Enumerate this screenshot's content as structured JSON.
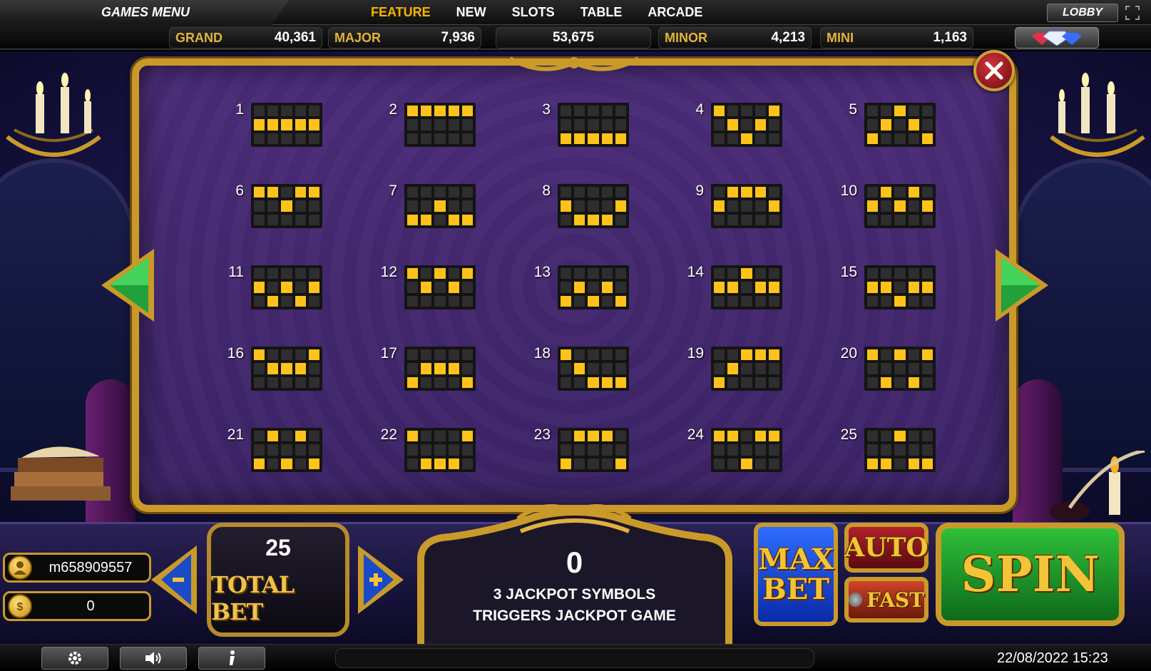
{
  "topbar": {
    "games_menu": "GAMES MENU",
    "tabs": [
      "FEATURE",
      "NEW",
      "SLOTS",
      "TABLE",
      "ARCADE"
    ],
    "active_tab": "FEATURE",
    "lobby": "LOBBY"
  },
  "jackpots": {
    "grand_label": "GRAND",
    "grand_value": "40,361",
    "major_label": "MAJOR",
    "major_value": "7,936",
    "center_value": "53,675",
    "minor_label": "MINOR",
    "minor_value": "4,213",
    "mini_label": "MINI",
    "mini_value": "1,163"
  },
  "paylines": [
    {
      "n": "1",
      "pattern": [
        "00000",
        "11111",
        "00000"
      ]
    },
    {
      "n": "2",
      "pattern": [
        "11111",
        "00000",
        "00000"
      ]
    },
    {
      "n": "3",
      "pattern": [
        "00000",
        "00000",
        "11111"
      ]
    },
    {
      "n": "4",
      "pattern": [
        "10001",
        "01010",
        "00100"
      ]
    },
    {
      "n": "5",
      "pattern": [
        "00100",
        "01010",
        "10001"
      ]
    },
    {
      "n": "6",
      "pattern": [
        "11011",
        "00100",
        "00000"
      ]
    },
    {
      "n": "7",
      "pattern": [
        "00000",
        "00100",
        "11011"
      ]
    },
    {
      "n": "8",
      "pattern": [
        "00000",
        "10001",
        "01110"
      ]
    },
    {
      "n": "9",
      "pattern": [
        "01110",
        "10001",
        "00000"
      ]
    },
    {
      "n": "10",
      "pattern": [
        "01010",
        "10101",
        "00000"
      ]
    },
    {
      "n": "11",
      "pattern": [
        "00000",
        "10101",
        "01010"
      ]
    },
    {
      "n": "12",
      "pattern": [
        "10101",
        "01010",
        "00000"
      ]
    },
    {
      "n": "13",
      "pattern": [
        "00000",
        "01010",
        "10101"
      ]
    },
    {
      "n": "14",
      "pattern": [
        "00100",
        "11011",
        "00000"
      ]
    },
    {
      "n": "15",
      "pattern": [
        "00000",
        "11011",
        "00100"
      ]
    },
    {
      "n": "16",
      "pattern": [
        "10001",
        "01110",
        "00000"
      ]
    },
    {
      "n": "17",
      "pattern": [
        "00000",
        "01110",
        "10001"
      ]
    },
    {
      "n": "18",
      "pattern": [
        "10000",
        "01000",
        "00111"
      ]
    },
    {
      "n": "19",
      "pattern": [
        "00111",
        "01000",
        "10000"
      ]
    },
    {
      "n": "20",
      "pattern": [
        "10101",
        "00000",
        "01010"
      ]
    },
    {
      "n": "21",
      "pattern": [
        "01010",
        "00000",
        "10101"
      ]
    },
    {
      "n": "22",
      "pattern": [
        "10001",
        "00000",
        "01110"
      ]
    },
    {
      "n": "23",
      "pattern": [
        "01110",
        "00000",
        "10001"
      ]
    },
    {
      "n": "24",
      "pattern": [
        "11011",
        "00000",
        "00100"
      ]
    },
    {
      "n": "25",
      "pattern": [
        "00100",
        "00000",
        "11011"
      ]
    }
  ],
  "player": {
    "username": "m658909557",
    "balance": "0"
  },
  "bet": {
    "value": "25",
    "label": "TOTAL BET"
  },
  "jackpot_info": {
    "count": "0",
    "line1": "3 JACKPOT SYMBOLS",
    "line2": "TRIGGERS JACKPOT GAME"
  },
  "buttons": {
    "max_bet_1": "MAX",
    "max_bet_2": "BET",
    "auto": "AUTO",
    "fast": "FAST",
    "spin": "SPIN"
  },
  "status": {
    "datetime": "22/08/2022 15:23"
  },
  "colors": {
    "gold": "#c99a2a",
    "active_tab": "#f4b400",
    "payline_on": "#ffc21a",
    "panel": "#3c2366"
  }
}
